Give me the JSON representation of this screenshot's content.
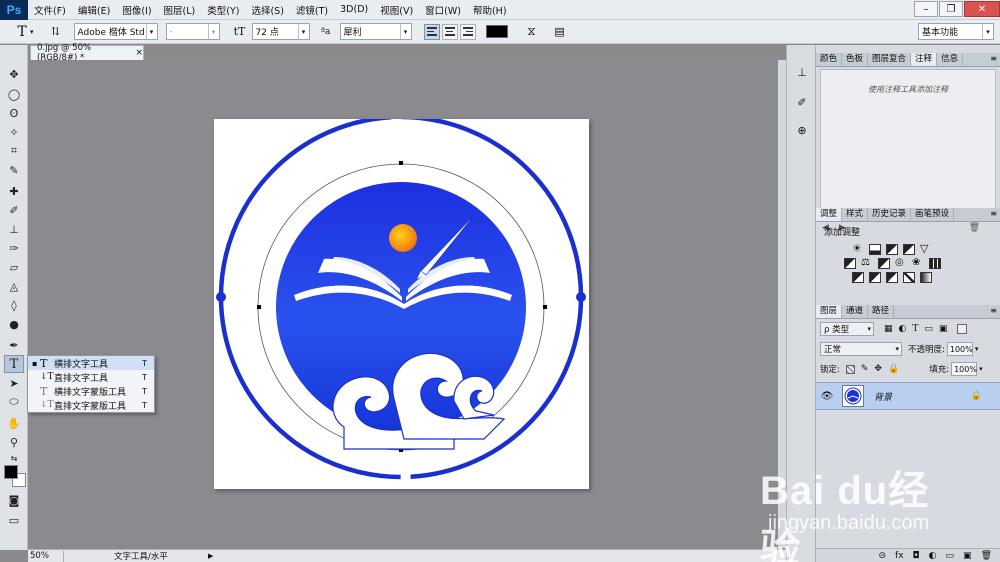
{
  "app": {
    "logo": "Ps"
  },
  "menu": [
    "文件(F)",
    "编辑(E)",
    "图像(I)",
    "图层(L)",
    "类型(Y)",
    "选择(S)",
    "滤镜(T)",
    "3D(D)",
    "视图(V)",
    "窗口(W)",
    "帮助(H)"
  ],
  "window_controls": {
    "minimize": "–",
    "restore": "❐",
    "close": "✕"
  },
  "options": {
    "tool_glyph": "T",
    "orient_glyph": "⇅",
    "font_family": "Adobe 楷体 Std",
    "font_style": "-",
    "size_glyph": "tT",
    "font_size": "72 点",
    "aa_glyph": "ªa",
    "antialias": "犀利",
    "text_color": "#000000",
    "warp_glyph": "⧖",
    "workspace": "基本功能"
  },
  "document": {
    "tab_title": "0.jpg @ 50%(RGB/8#) *",
    "tab_close": "×"
  },
  "status": {
    "zoom": "50%",
    "text": "文字工具/水平",
    "arrow": "▶"
  },
  "flyout": {
    "items": [
      {
        "bullet": "▪",
        "icon": "T",
        "label": "横排文字工具",
        "key": "T"
      },
      {
        "bullet": "",
        "icon": "↓T",
        "label": "直排文字工具",
        "key": "T"
      },
      {
        "bullet": "",
        "icon": "T",
        "label": "横排文字蒙版工具",
        "key": "T"
      },
      {
        "bullet": "",
        "icon": "↓T",
        "label": "直排文字蒙版工具",
        "key": "T"
      }
    ]
  },
  "panels": {
    "top_tabs": [
      "颜色",
      "色板",
      "图层复合",
      "注释",
      "信息"
    ],
    "notes_hint": "使用注释工具添加注释",
    "adj_tabs": [
      "调整",
      "样式",
      "历史记录",
      "画笔预设"
    ],
    "adj_title": "添加调整",
    "layers_tabs": [
      "图层",
      "通道",
      "路径"
    ],
    "layer_filter": "ρ 类型",
    "blend_mode": "正常",
    "opacity_label": "不透明度:",
    "opacity_value": "100%",
    "lock_label": "锁定:",
    "fill_label": "填充:",
    "fill_value": "100%",
    "layer_name": "背景",
    "menu_glyph": "≡",
    "eye_glyph": "👁",
    "lock_glyph": "🔒",
    "footer_icons": [
      "⊝",
      "fx",
      "◘",
      "◐",
      "▭",
      "▣",
      "🗑"
    ]
  },
  "watermark": {
    "brand": "Bai du经验",
    "url": "jingyan.baidu.com"
  },
  "colors": {
    "accent_blue": "#1a2fd0",
    "sun_orange": "#f7a600",
    "selection_row": "#b9cff0"
  }
}
